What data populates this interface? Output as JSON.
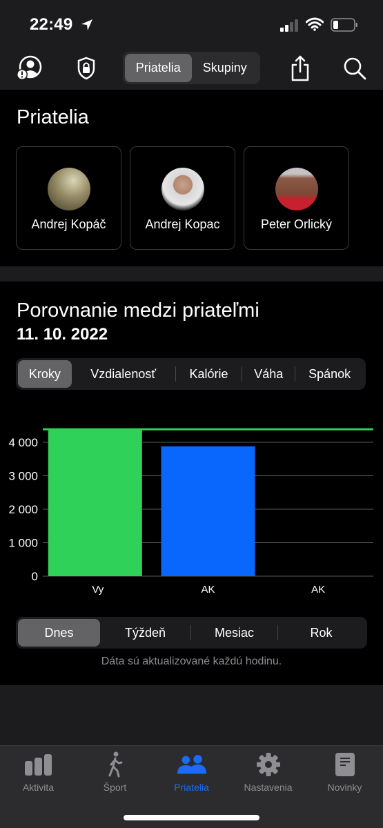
{
  "status_bar": {
    "time": "22:49",
    "icons": [
      "location-arrow-icon",
      "cellular-signal-icon",
      "wifi-icon",
      "battery-icon"
    ]
  },
  "nav": {
    "left_icons": [
      "friend-requests-icon",
      "privacy-shield-icon"
    ],
    "segments": [
      {
        "label": "Priatelia",
        "active": true
      },
      {
        "label": "Skupiny",
        "active": false
      }
    ],
    "right_icons": [
      "share-icon",
      "search-icon"
    ]
  },
  "friends_section": {
    "title": "Priatelia",
    "friends": [
      {
        "name": "Andrej Kopáč"
      },
      {
        "name": "Andrej Kopac"
      },
      {
        "name": "Peter Orlický"
      }
    ]
  },
  "comparison": {
    "title": "Porovnanie medzi priateľmi",
    "date": "11. 10. 2022",
    "metrics": [
      {
        "label": "Kroky",
        "active": true
      },
      {
        "label": "Vzdialenosť",
        "active": false
      },
      {
        "label": "Kalórie",
        "active": false
      },
      {
        "label": "Váha",
        "active": false
      },
      {
        "label": "Spánok",
        "active": false
      }
    ],
    "periods": [
      {
        "label": "Dnes",
        "active": true
      },
      {
        "label": "Týždeň",
        "active": false
      },
      {
        "label": "Mesiac",
        "active": false
      },
      {
        "label": "Rok",
        "active": false
      }
    ],
    "update_note": "Dáta sú aktualizované každú hodinu."
  },
  "chart_data": {
    "type": "bar",
    "title": "",
    "xlabel": "",
    "ylabel": "",
    "categories": [
      "Vy",
      "AK",
      "AK"
    ],
    "values": [
      4390,
      3880,
      0
    ],
    "colors": [
      "#30d158",
      "#0a67fd",
      "#0a67fd"
    ],
    "reference_line": {
      "value": 4390,
      "color": "#30d158"
    },
    "yticks": [
      0,
      1000,
      2000,
      3000,
      4000
    ],
    "ytick_labels": [
      "0",
      "1 000",
      "2 000",
      "3 000",
      "4 000"
    ],
    "ylim": [
      0,
      4400
    ],
    "grid": true
  },
  "tabbar": {
    "tabs": [
      {
        "label": "Aktivita",
        "icon": "activity-bars-icon",
        "active": false
      },
      {
        "label": "Šport",
        "icon": "walking-figure-icon",
        "active": false
      },
      {
        "label": "Priatelia",
        "icon": "friends-icon",
        "active": true
      },
      {
        "label": "Nastavenia",
        "icon": "gear-icon",
        "active": false
      },
      {
        "label": "Novinky",
        "icon": "news-document-icon",
        "active": false
      }
    ],
    "active_color": "#1a6cf6",
    "inactive_color": "#8e8e93"
  }
}
